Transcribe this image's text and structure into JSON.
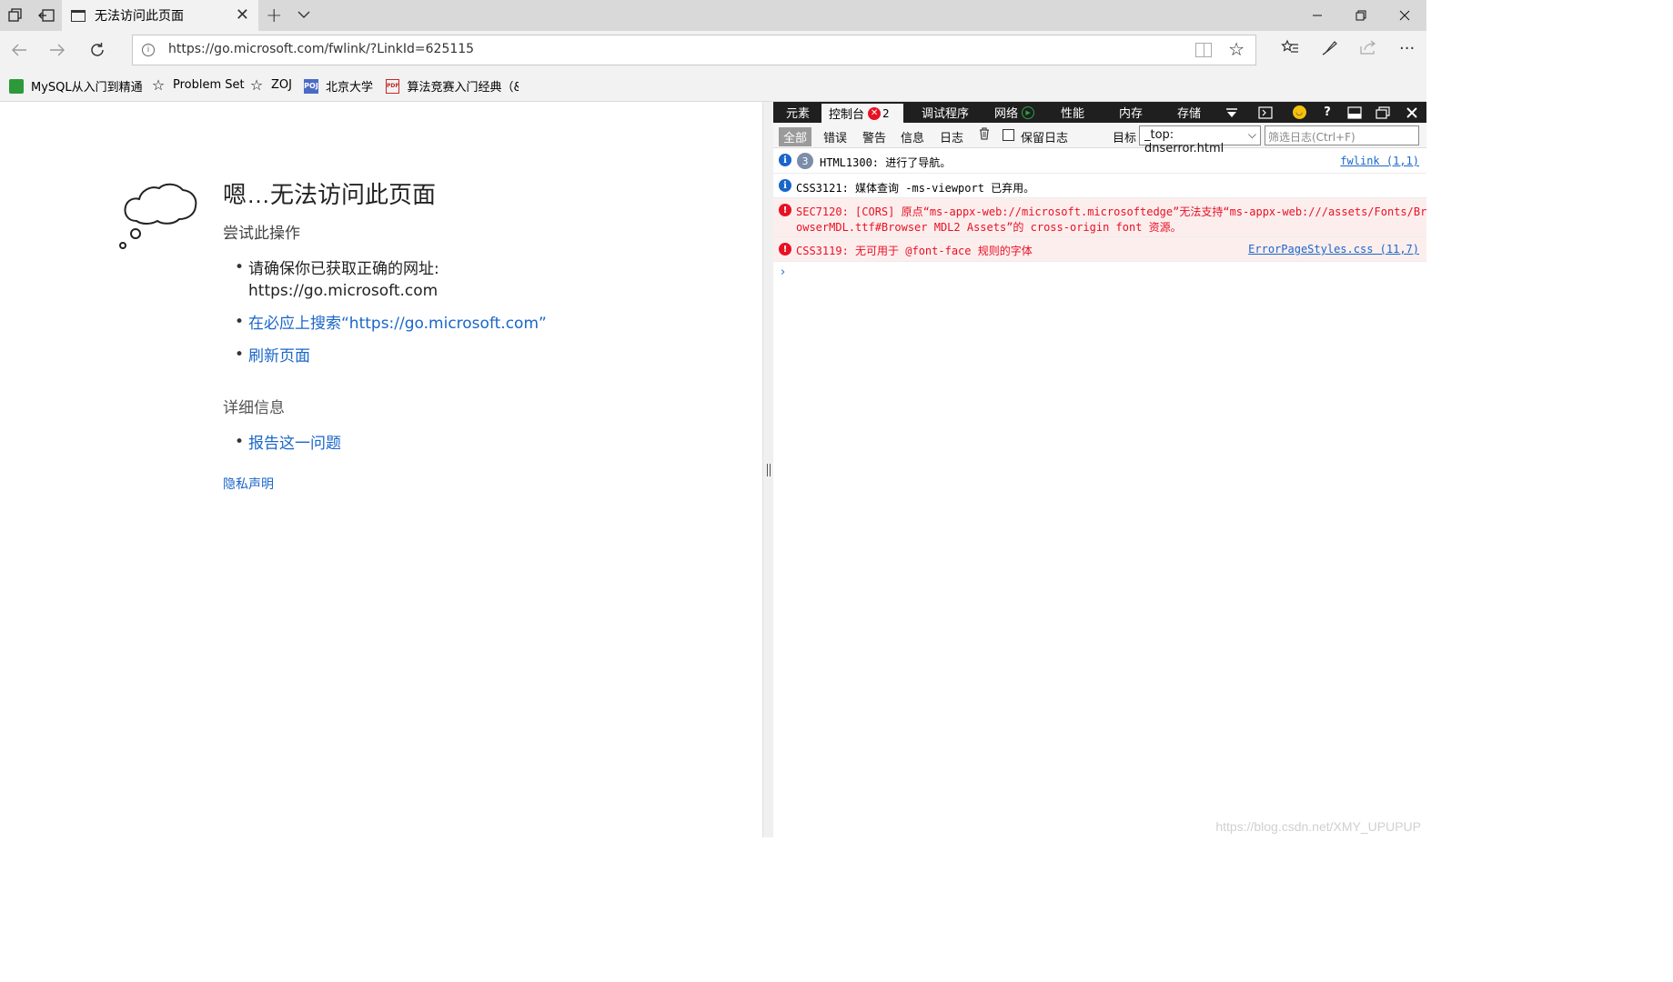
{
  "browser": {
    "tab": {
      "title": "无法访问此页面"
    },
    "url": "https://go.microsoft.com/fwlink/?LinkId=625115",
    "favorites": [
      {
        "label": "MySQL从入门到精通",
        "icon": "green-book-icon"
      },
      {
        "label": "Problem Set",
        "icon": "star-icon"
      },
      {
        "label": "ZOJ",
        "icon": "star-icon"
      },
      {
        "label": "北京大学",
        "icon": "poj-icon"
      },
      {
        "label": "算法竞赛入门经典（&",
        "icon": "pdf-icon"
      }
    ],
    "poj_badge": "POJ",
    "pdf_badge": "PDF"
  },
  "page": {
    "title": "嗯…无法访问此页面",
    "try_label": "尝试此操作",
    "bullets": {
      "ensure_line1": "请确保你已获取正确的网址:",
      "ensure_line2": "https://go.microsoft.com",
      "search": "在必应上搜索“https://go.microsoft.com”",
      "refresh": "刷新页面"
    },
    "detail_label": "详细信息",
    "report": "报告这一问题",
    "privacy": "隐私声明"
  },
  "devtools": {
    "tabs": {
      "elements": "元素",
      "console": "控制台",
      "console_error_count": "2",
      "debugger": "调试程序",
      "network": "网络",
      "performance": "性能",
      "memory": "内存",
      "storage": "存储"
    },
    "filters": {
      "all": "全部",
      "errors": "错误",
      "warnings": "警告",
      "info": "信息",
      "logs": "日志",
      "keep_log": "保留日志",
      "target_label": "目标",
      "target_value": "_top: dnserror.html",
      "filter_placeholder": "筛选日志(Ctrl+F)"
    },
    "messages": [
      {
        "type": "info",
        "count": "3",
        "text": "HTML1300: 进行了导航。",
        "source": "fwlink (1,1)"
      },
      {
        "type": "info",
        "text": "CSS3121: 媒体查询 -ms-viewport 已弃用。"
      },
      {
        "type": "error",
        "line1": "SEC7120: [CORS] 原点“ms-appx-web://microsoft.microsoftedge”无法支持“ms-appx-web:///assets/Fonts/Br",
        "line2": "owserMDL.ttf#Browser MDL2 Assets”的 cross-origin font 资源。"
      },
      {
        "type": "error",
        "text": "CSS3119: 无可用于 @font-face 规则的字体",
        "source": "ErrorPageStyles.css (11,7)"
      }
    ],
    "prompt": "›"
  },
  "watermark": "https://blog.csdn.net/XMY_UPUPUP",
  "colors": {
    "link": "#1a66c9",
    "error": "#e81123",
    "devtools_bar": "#1f1f1f"
  }
}
